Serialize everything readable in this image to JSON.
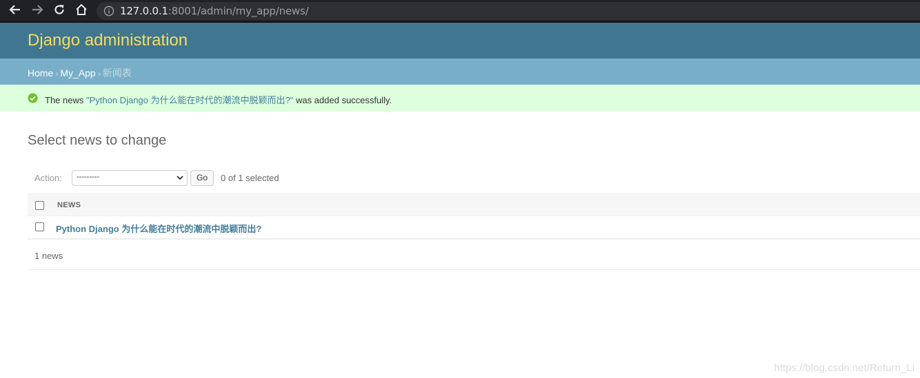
{
  "browser": {
    "url_host": "127.0.0.1",
    "url_rest": ":8001/admin/my_app/news/"
  },
  "header": {
    "site_name": "Django administration"
  },
  "breadcrumbs": {
    "home": "Home",
    "app": "My_App",
    "current": "新闻表",
    "separator": "›"
  },
  "message": {
    "prefix": "The news ",
    "link": "\"Python Django 为什么能在时代的潮流中脱颖而出?\"",
    "suffix": " was added successfully."
  },
  "page": {
    "title": "Select news to change"
  },
  "actions": {
    "label": "Action:",
    "selected_option": "---------",
    "go_label": "Go",
    "selected_count": "0 of 1 selected"
  },
  "table": {
    "header": "NEWS",
    "rows": [
      {
        "title": "Python Django 为什么能在时代的潮流中脱颖而出?"
      }
    ]
  },
  "paginator": {
    "text": "1 news"
  },
  "watermark": "https://blog.csdn.net/Return_Li",
  "colors": {
    "header_bg": "#417690",
    "site_name": "#f5dd5d",
    "breadcrumbs_bg": "#79aec8",
    "success_bg": "#ddffdd",
    "link": "#447e9b"
  },
  "icons": {
    "back": "arrow-left-icon",
    "forward": "arrow-right-icon",
    "reload": "reload-icon",
    "home": "home-icon",
    "info": "info-icon",
    "success": "check-circle-icon"
  }
}
